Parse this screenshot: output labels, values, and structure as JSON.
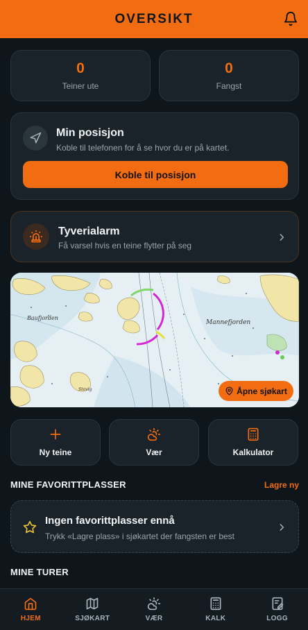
{
  "header": {
    "title": "OVERSIKT",
    "icon": "bell-icon"
  },
  "stats": [
    {
      "value": "0",
      "label": "Teiner ute"
    },
    {
      "value": "0",
      "label": "Fangst"
    }
  ],
  "position": {
    "title": "Min posisjon",
    "subtitle": "Koble til telefonen for å se hvor du er på kartet.",
    "button": "Koble til posisjon",
    "icon": "navigation-arrow-icon"
  },
  "alarm": {
    "title": "Tyverialarm",
    "subtitle": "Få varsel hvis en teine flytter på seg",
    "icon": "siren-icon"
  },
  "map": {
    "button": "Åpne sjøkart",
    "labels": [
      "Baufjorden",
      "Mannefjorden",
      "Stovig"
    ]
  },
  "quick_actions": [
    {
      "label": "Ny teine",
      "icon": "plus-icon"
    },
    {
      "label": "Vær",
      "icon": "weather-icon"
    },
    {
      "label": "Kalkulator",
      "icon": "calculator-icon"
    }
  ],
  "favorites": {
    "title": "MINE FAVORITTPLASSER",
    "link": "Lagre ny",
    "empty_title": "Ingen favorittplasser ennå",
    "empty_sub": "Trykk «Lagre plass» i sjøkartet der fangsten er best",
    "icon": "star-icon"
  },
  "trips": {
    "title": "MINE TURER"
  },
  "nav": [
    {
      "label": "HJEM",
      "icon": "home-icon",
      "active": true
    },
    {
      "label": "SJØKART",
      "icon": "map-icon",
      "active": false
    },
    {
      "label": "VÆR",
      "icon": "weather-icon",
      "active": false
    },
    {
      "label": "KALK",
      "icon": "calculator-icon",
      "active": false
    },
    {
      "label": "LOGG",
      "icon": "logbook-icon",
      "active": false
    }
  ],
  "colors": {
    "accent": "#f26d12",
    "background": "#0f161b",
    "card": "#1a2329"
  }
}
